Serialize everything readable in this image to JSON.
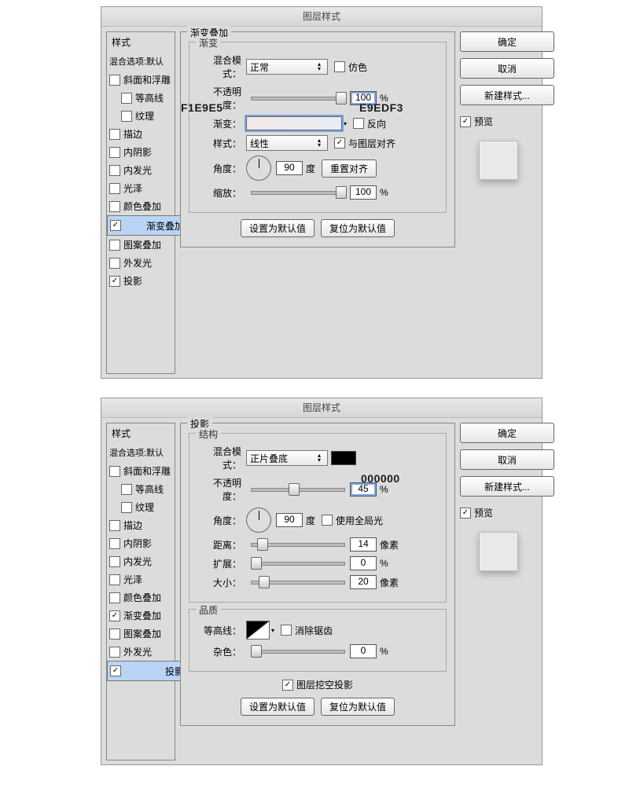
{
  "shared": {
    "dialog_title": "图层样式",
    "sidebar_header": "样式",
    "blend_options": "混合选项:默认",
    "items": {
      "bevel": "斜面和浮雕",
      "contour": "等高线",
      "texture": "纹理",
      "stroke": "描边",
      "inner_shadow": "内阴影",
      "inner_glow": "内发光",
      "satin": "光泽",
      "color_overlay": "颜色叠加",
      "gradient_overlay": "渐变叠加",
      "pattern_overlay": "图案叠加",
      "outer_glow": "外发光",
      "drop_shadow": "投影"
    },
    "buttons": {
      "ok": "确定",
      "cancel": "取消",
      "new_style": "新建样式...",
      "preview": "预览",
      "reset_align": "重置对齐",
      "default_set": "设置为默认值",
      "default_reset": "复位为默认值"
    }
  },
  "panel1": {
    "group_title": "渐变叠加",
    "sub_title": "渐变",
    "blend_mode_label": "混合模式：",
    "blend_mode_value": "正常",
    "dither": "仿色",
    "opacity_label": "不透明度：",
    "opacity_value": "100",
    "opacity_unit": "%",
    "gradient_label": "渐变：",
    "reverse": "反向",
    "style_label": "样式：",
    "style_value": "线性",
    "align_layer": "与图层对齐",
    "angle_label": "角度：",
    "angle_value": "90",
    "angle_unit": "度",
    "scale_label": "缩放：",
    "scale_value": "100",
    "scale_unit": "%",
    "grad_left": "F1E9E5",
    "grad_right": "E9EDF3"
  },
  "panel2": {
    "group_title": "投影",
    "struct_title": "结构",
    "quality_title": "品质",
    "blend_mode_label": "混合模式：",
    "blend_mode_value": "正片叠底",
    "color_hex": "000000",
    "opacity_label": "不透明度：",
    "opacity_value": "45",
    "angle_label": "角度：",
    "angle_value": "90",
    "angle_unit": "度",
    "global_light": "使用全局光",
    "distance_label": "距离：",
    "distance_value": "14",
    "px": "像素",
    "spread_label": "扩展：",
    "spread_value": "0",
    "pct": "%",
    "size_label": "大小：",
    "size_value": "20",
    "contour_label": "等高线：",
    "anti_alias": "消除锯齿",
    "noise_label": "杂色：",
    "noise_value": "0",
    "knockout": "图层挖空投影"
  }
}
